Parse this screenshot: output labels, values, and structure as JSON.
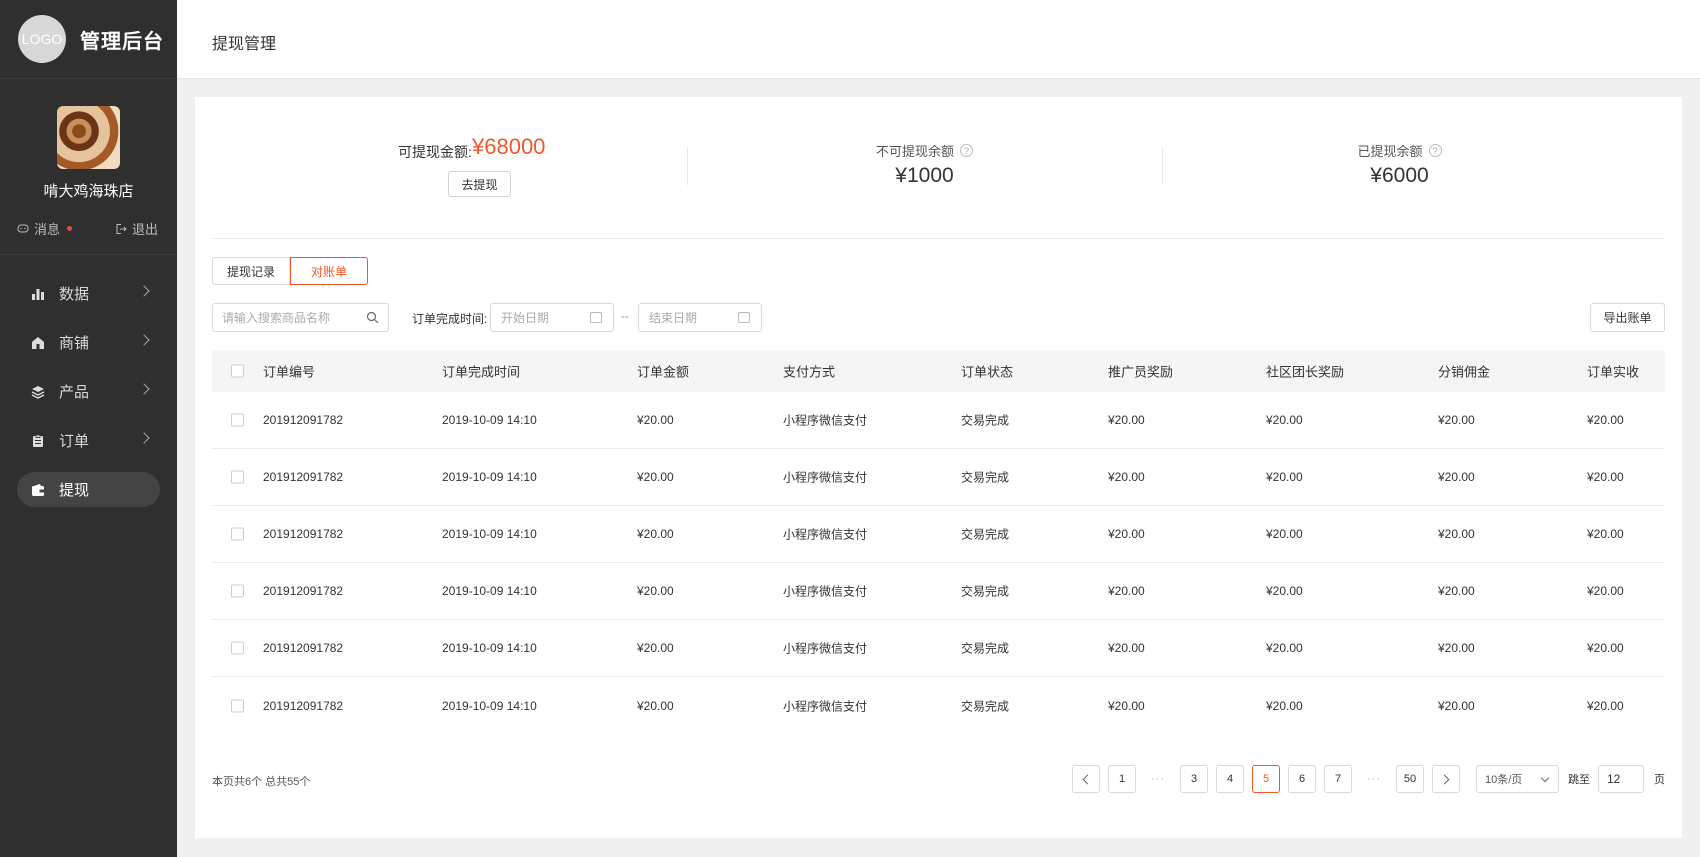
{
  "brand": {
    "logo_text": "LOGO",
    "title": "管理后台"
  },
  "profile": {
    "shop_name": "啃大鸡海珠店",
    "messages_label": "消息",
    "logout_label": "退出"
  },
  "nav": [
    {
      "label": "数据",
      "icon": "bar-chart-icon",
      "active": false,
      "has_children": true
    },
    {
      "label": "商铺",
      "icon": "store-icon",
      "active": false,
      "has_children": true
    },
    {
      "label": "产品",
      "icon": "layers-icon",
      "active": false,
      "has_children": true
    },
    {
      "label": "订单",
      "icon": "clipboard-icon",
      "active": false,
      "has_children": true
    },
    {
      "label": "提现",
      "icon": "wallet-icon",
      "active": true,
      "has_children": false
    }
  ],
  "header": {
    "title": "提现管理"
  },
  "summary": {
    "available_label": "可提现金额:",
    "available_amount": "¥68000",
    "withdraw_button": "去提现",
    "locked_label": "不可提现余额",
    "locked_amount": "¥1000",
    "withdrawn_label": "已提现余额",
    "withdrawn_amount": "¥6000",
    "help_glyph": "?"
  },
  "tabs": [
    {
      "label": "提现记录",
      "active": false
    },
    {
      "label": "对账单",
      "active": true
    }
  ],
  "filters": {
    "search_placeholder": "请输入搜索商品名称",
    "date_label": "订单完成时间:",
    "start_placeholder": "开始日期",
    "separator": "--",
    "end_placeholder": "结束日期",
    "export_button": "导出账单"
  },
  "table": {
    "columns": [
      "订单编号",
      "订单完成时间",
      "订单金额",
      "支付方式",
      "订单状态",
      "推广员奖励",
      "社区团长奖励",
      "分销佣金",
      "订单实收"
    ],
    "rows": [
      [
        "201912091782",
        "2019-10-09 14:10",
        "¥20.00",
        "小程序微信支付",
        "交易完成",
        "¥20.00",
        "¥20.00",
        "¥20.00",
        "¥20.00"
      ],
      [
        "201912091782",
        "2019-10-09 14:10",
        "¥20.00",
        "小程序微信支付",
        "交易完成",
        "¥20.00",
        "¥20.00",
        "¥20.00",
        "¥20.00"
      ],
      [
        "201912091782",
        "2019-10-09 14:10",
        "¥20.00",
        "小程序微信支付",
        "交易完成",
        "¥20.00",
        "¥20.00",
        "¥20.00",
        "¥20.00"
      ],
      [
        "201912091782",
        "2019-10-09 14:10",
        "¥20.00",
        "小程序微信支付",
        "交易完成",
        "¥20.00",
        "¥20.00",
        "¥20.00",
        "¥20.00"
      ],
      [
        "201912091782",
        "2019-10-09 14:10",
        "¥20.00",
        "小程序微信支付",
        "交易完成",
        "¥20.00",
        "¥20.00",
        "¥20.00",
        "¥20.00"
      ],
      [
        "201912091782",
        "2019-10-09 14:10",
        "¥20.00",
        "小程序微信支付",
        "交易完成",
        "¥20.00",
        "¥20.00",
        "¥20.00",
        "¥20.00"
      ]
    ]
  },
  "pagination": {
    "info": "本页共6个  总共55个",
    "pages": [
      "1",
      "···",
      "3",
      "4",
      "5",
      "6",
      "7",
      "···",
      "50"
    ],
    "active_page": "5",
    "page_size": "10条/页",
    "jump_label": "跳至",
    "jump_value": "12",
    "page_suffix": "页"
  },
  "colors": {
    "accent": "#f2572c",
    "sidebar": "#2f2f2f"
  }
}
